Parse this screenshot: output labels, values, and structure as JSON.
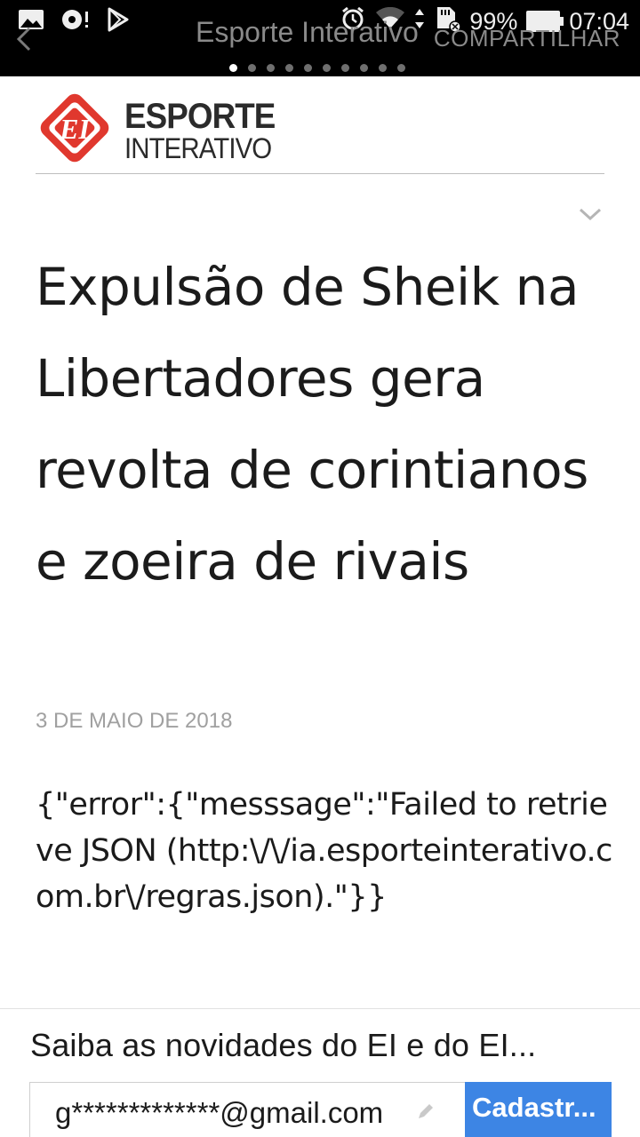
{
  "status_bar": {
    "battery": "99%",
    "time": "07:04",
    "icons": [
      "image-icon",
      "record-icon",
      "play-store-icon",
      "alarm-icon",
      "wifi-icon",
      "data-arrows-icon",
      "sd-card-icon",
      "battery-icon"
    ]
  },
  "app_bar": {
    "title": "Esporte Interativo",
    "share_label": "COMPARTILHAR",
    "back_icon": "back-chevron-icon",
    "page_count": 10,
    "active_page": 0
  },
  "brand": {
    "logo_mark": "EI",
    "word1": "ESPORTE",
    "word2": "INTERATIVO",
    "accent_color": "#e0382e"
  },
  "article": {
    "headline": "Expulsão de Sheik na Libertadores gera revolta de corintianos e zoeira de rivais",
    "date": "3 DE MAIO DE 2018",
    "body": "{\"error\":{\"messsage\":\"Failed to retrieve JSON (http:\\/\\/ia.esporteinterativo.com.br\\/regras.json).\"}}"
  },
  "newsletter": {
    "title": "Saiba as novidades do EI e do EI...",
    "email_value": "g*************@gmail.com",
    "button_label": "Cadastr...",
    "button_color": "#3d85e4"
  }
}
